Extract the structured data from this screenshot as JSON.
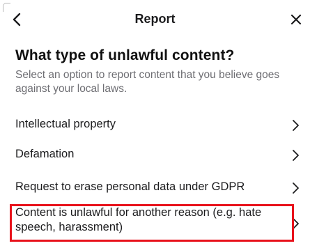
{
  "header": {
    "title": "Report",
    "back_icon": "chevron-left-icon",
    "close_icon": "close-icon"
  },
  "question": {
    "title": "What type of unlawful content?",
    "subtitle": "Select an option to report content that you believe goes against your local laws."
  },
  "options": [
    {
      "label": "Intellectual property",
      "icon": "chevron-right-icon"
    },
    {
      "label": "Defamation",
      "icon": "chevron-right-icon"
    },
    {
      "label": "Request to erase personal data under GDPR",
      "icon": "chevron-right-icon"
    },
    {
      "label": "Content is unlawful for another reason (e.g. hate speech, harassment)",
      "icon": "chevron-right-icon",
      "highlighted": true
    }
  ],
  "colors": {
    "highlight": "#e8121b",
    "text": "#1c1c1e",
    "subtitle": "#6e6e73",
    "background": "#ffffff"
  }
}
